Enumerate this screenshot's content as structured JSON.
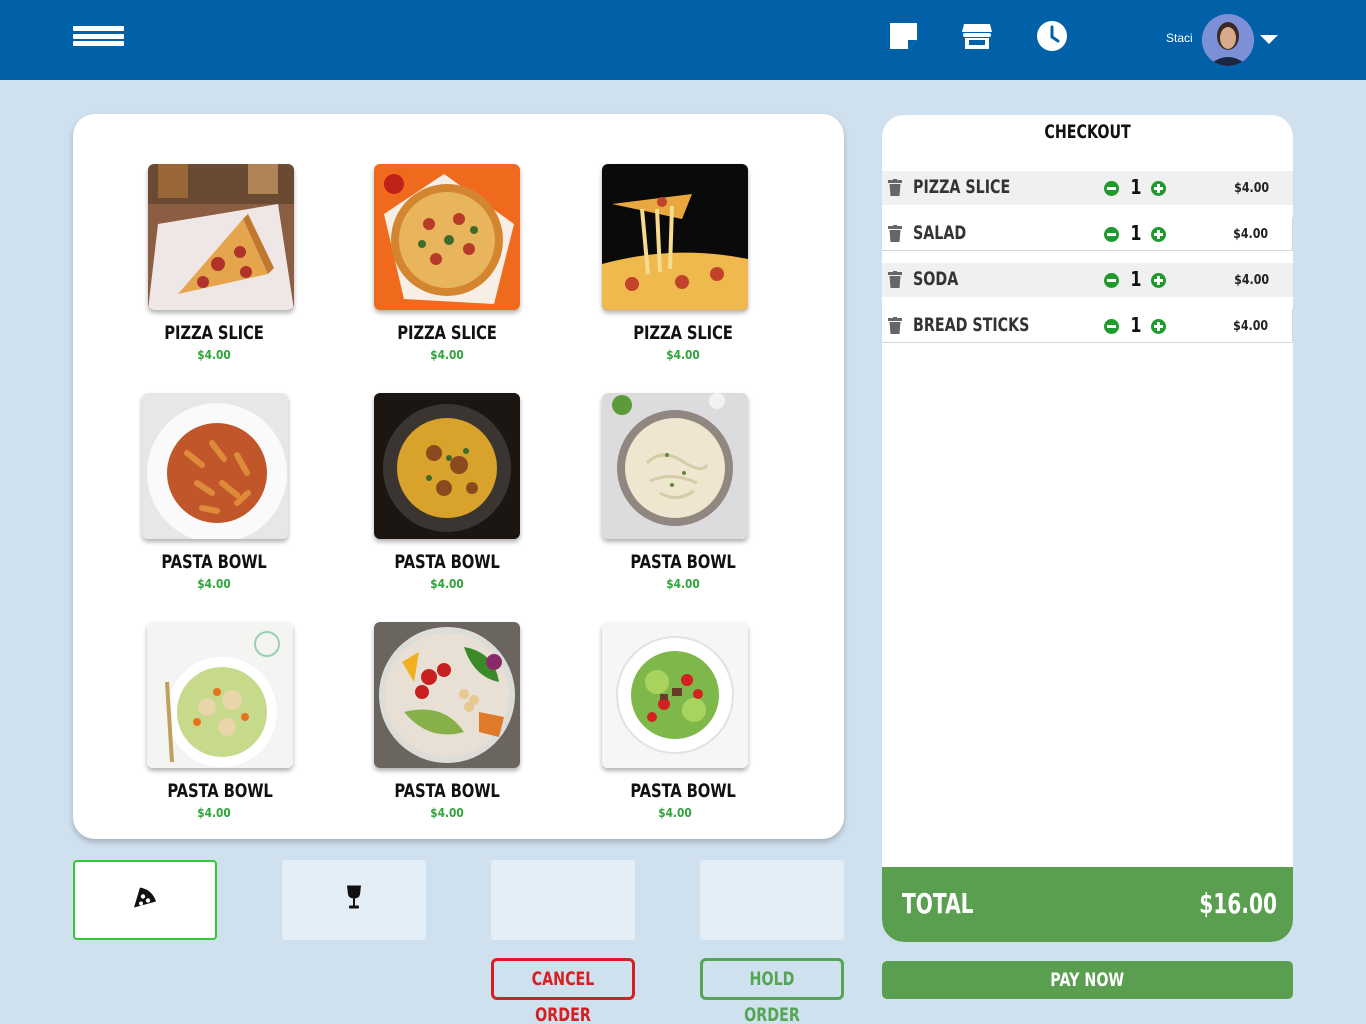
{
  "header": {
    "user_name": "Staci",
    "icons": [
      "menu-icon",
      "note-icon",
      "store-icon",
      "clock-icon",
      "chevron-down-icon"
    ]
  },
  "menu": {
    "items": [
      {
        "name": "PIZZA SLICE",
        "price": "$4.00"
      },
      {
        "name": "PIZZA SLICE",
        "price": "$4.00"
      },
      {
        "name": "PIZZA SLICE",
        "price": "$4.00"
      },
      {
        "name": "PASTA BOWL",
        "price": "$4.00"
      },
      {
        "name": "PASTA BOWL",
        "price": "$4.00"
      },
      {
        "name": "PASTA BOWL",
        "price": "$4.00"
      },
      {
        "name": "PASTA BOWL",
        "price": "$4.00"
      },
      {
        "name": "PASTA BOWL",
        "price": "$4.00"
      },
      {
        "name": "PASTA BOWL",
        "price": "$4.00"
      }
    ]
  },
  "categories": [
    {
      "icon": "pizza-icon",
      "active": true
    },
    {
      "icon": "wine-glass-icon",
      "active": false
    },
    {
      "icon": "",
      "active": false
    },
    {
      "icon": "",
      "active": false
    }
  ],
  "actions": {
    "cancel_label": "CANCEL ORDER",
    "hold_label": "HOLD ORDER",
    "pay_label": "PAY NOW"
  },
  "checkout": {
    "title": "CHECKOUT",
    "items": [
      {
        "name": "PIZZA SLICE",
        "qty": "1",
        "price": "$4.00"
      },
      {
        "name": "SALAD",
        "qty": "1",
        "price": "$4.00"
      },
      {
        "name": "SODA",
        "qty": "1",
        "price": "$4.00"
      },
      {
        "name": "BREAD STICKS",
        "qty": "1",
        "price": "$4.00"
      }
    ],
    "total_label": "TOTAL",
    "total_value": "$16.00"
  },
  "colors": {
    "header": "#0061a8",
    "background": "#cfe0ee",
    "price_green": "#2ea43a",
    "total_green": "#5a9f50",
    "cancel_red": "#d42020",
    "active_border": "#35c635"
  }
}
